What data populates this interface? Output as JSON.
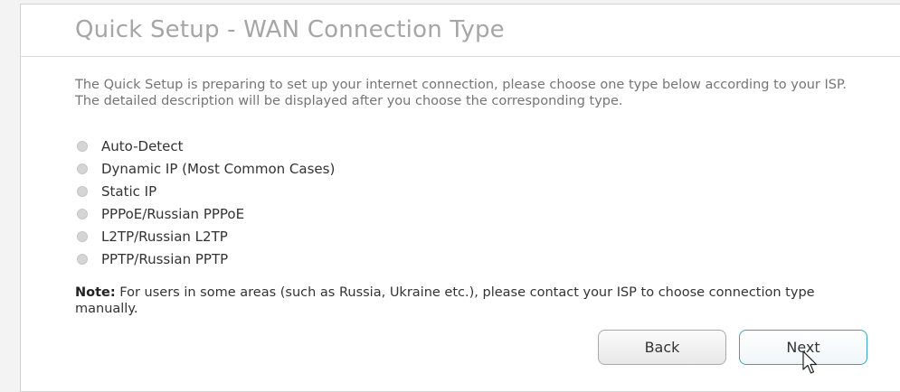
{
  "page": {
    "title": "Quick Setup - WAN Connection Type",
    "intro": "The Quick Setup is preparing to set up your internet connection, please choose one type below according to your ISP. The detailed description will be displayed after you choose the corresponding type."
  },
  "connection_types": [
    {
      "label": "Auto-Detect"
    },
    {
      "label": "Dynamic IP (Most Common Cases)"
    },
    {
      "label": "Static IP"
    },
    {
      "label": "PPPoE/Russian PPPoE"
    },
    {
      "label": "L2TP/Russian L2TP"
    },
    {
      "label": "PPTP/Russian PPTP"
    }
  ],
  "note": {
    "label": "Note:",
    "text": " For users in some areas (such as Russia, Ukraine etc.), please contact your ISP to choose connection type manually."
  },
  "buttons": {
    "back": "Back",
    "next": "Next"
  },
  "colors": {
    "title": "#a6a6a6",
    "accent_border": "#3aa2c8",
    "radio_fill": "#d5d5d5"
  },
  "icons": {
    "cursor": "mouse-pointer-icon"
  }
}
